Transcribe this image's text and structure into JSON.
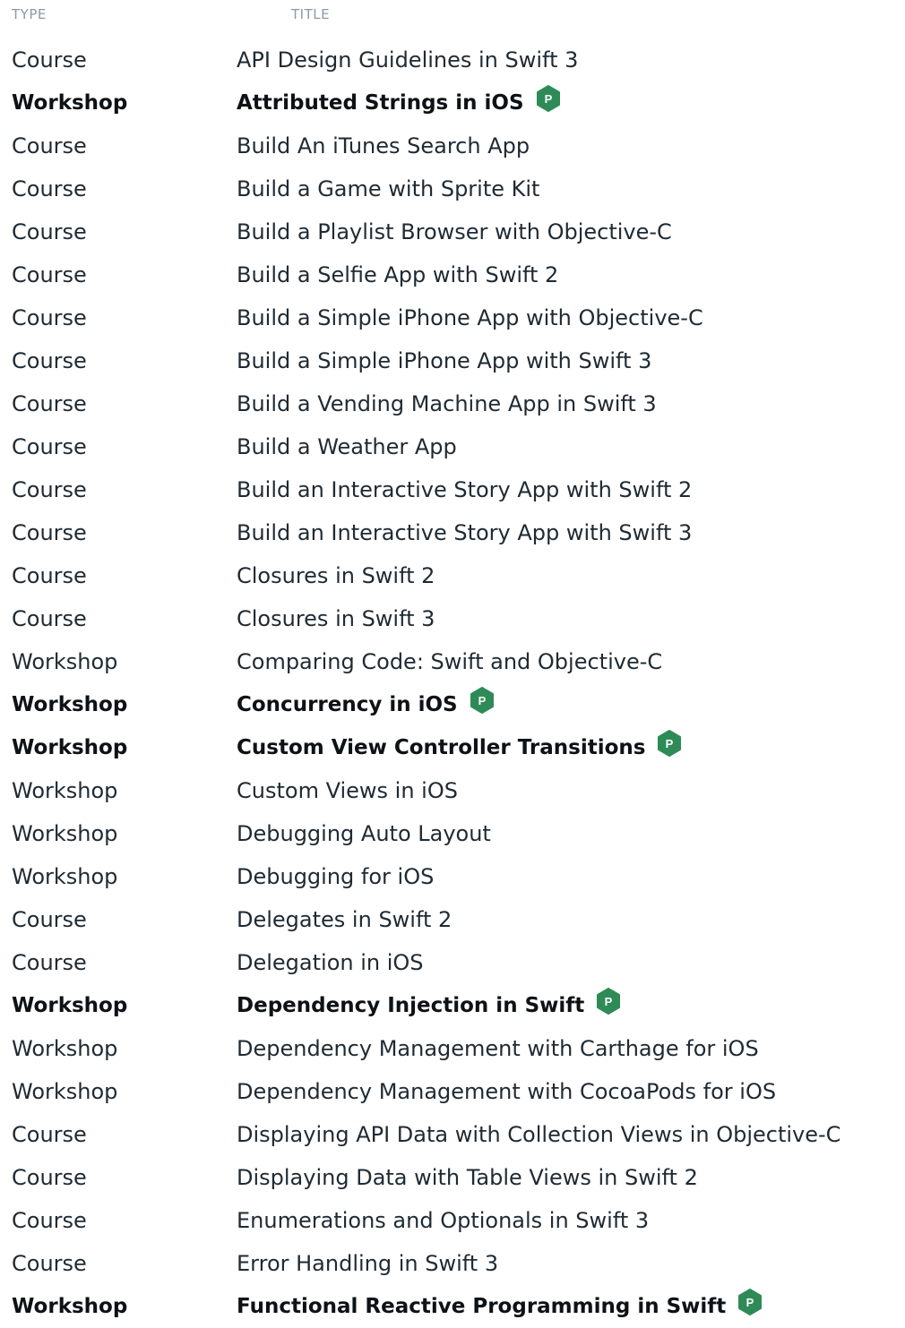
{
  "header": {
    "type_label": "TYPE",
    "title_label": "TITLE"
  },
  "colors": {
    "badge": "#2e8b57",
    "text": "#1f2a33",
    "header": "#8a9aa8"
  },
  "rows": [
    {
      "type": "Course",
      "title": "API Design Guidelines in Swift 3",
      "premium": false
    },
    {
      "type": "Workshop",
      "title": "Attributed Strings in iOS",
      "premium": true,
      "badge": "P"
    },
    {
      "type": "Course",
      "title": "Build An iTunes Search App",
      "premium": false
    },
    {
      "type": "Course",
      "title": "Build a Game with Sprite Kit",
      "premium": false
    },
    {
      "type": "Course",
      "title": "Build a Playlist Browser with Objective-C",
      "premium": false
    },
    {
      "type": "Course",
      "title": "Build a Selfie App with Swift 2",
      "premium": false
    },
    {
      "type": "Course",
      "title": "Build a Simple iPhone App with Objective-C",
      "premium": false
    },
    {
      "type": "Course",
      "title": "Build a Simple iPhone App with Swift 3",
      "premium": false
    },
    {
      "type": "Course",
      "title": "Build a Vending Machine App in Swift 3",
      "premium": false
    },
    {
      "type": "Course",
      "title": "Build a Weather App",
      "premium": false
    },
    {
      "type": "Course",
      "title": "Build an Interactive Story App with Swift 2",
      "premium": false
    },
    {
      "type": "Course",
      "title": "Build an Interactive Story App with Swift 3",
      "premium": false
    },
    {
      "type": "Course",
      "title": "Closures in Swift 2",
      "premium": false
    },
    {
      "type": "Course",
      "title": "Closures in Swift 3",
      "premium": false
    },
    {
      "type": "Workshop",
      "title": "Comparing Code: Swift and Objective-C",
      "premium": false
    },
    {
      "type": "Workshop",
      "title": "Concurrency in iOS",
      "premium": true,
      "badge": "P"
    },
    {
      "type": "Workshop",
      "title": "Custom View Controller Transitions",
      "premium": true,
      "badge": "P"
    },
    {
      "type": "Workshop",
      "title": "Custom Views in iOS",
      "premium": false
    },
    {
      "type": "Workshop",
      "title": "Debugging Auto Layout",
      "premium": false
    },
    {
      "type": "Workshop",
      "title": "Debugging for iOS",
      "premium": false
    },
    {
      "type": "Course",
      "title": "Delegates in Swift 2",
      "premium": false
    },
    {
      "type": "Course",
      "title": "Delegation in iOS",
      "premium": false
    },
    {
      "type": "Workshop",
      "title": "Dependency Injection in Swift",
      "premium": true,
      "badge": "P"
    },
    {
      "type": "Workshop",
      "title": "Dependency Management with Carthage for iOS",
      "premium": false
    },
    {
      "type": "Workshop",
      "title": "Dependency Management with CocoaPods for iOS",
      "premium": false
    },
    {
      "type": "Course",
      "title": "Displaying API Data with Collection Views in Objective-C",
      "premium": false
    },
    {
      "type": "Course",
      "title": "Displaying Data with Table Views in Swift 2",
      "premium": false
    },
    {
      "type": "Course",
      "title": "Enumerations and Optionals in Swift 3",
      "premium": false
    },
    {
      "type": "Course",
      "title": "Error Handling in Swift 3",
      "premium": false
    },
    {
      "type": "Workshop",
      "title": "Functional Reactive Programming in Swift",
      "premium": true,
      "badge": "P"
    }
  ]
}
